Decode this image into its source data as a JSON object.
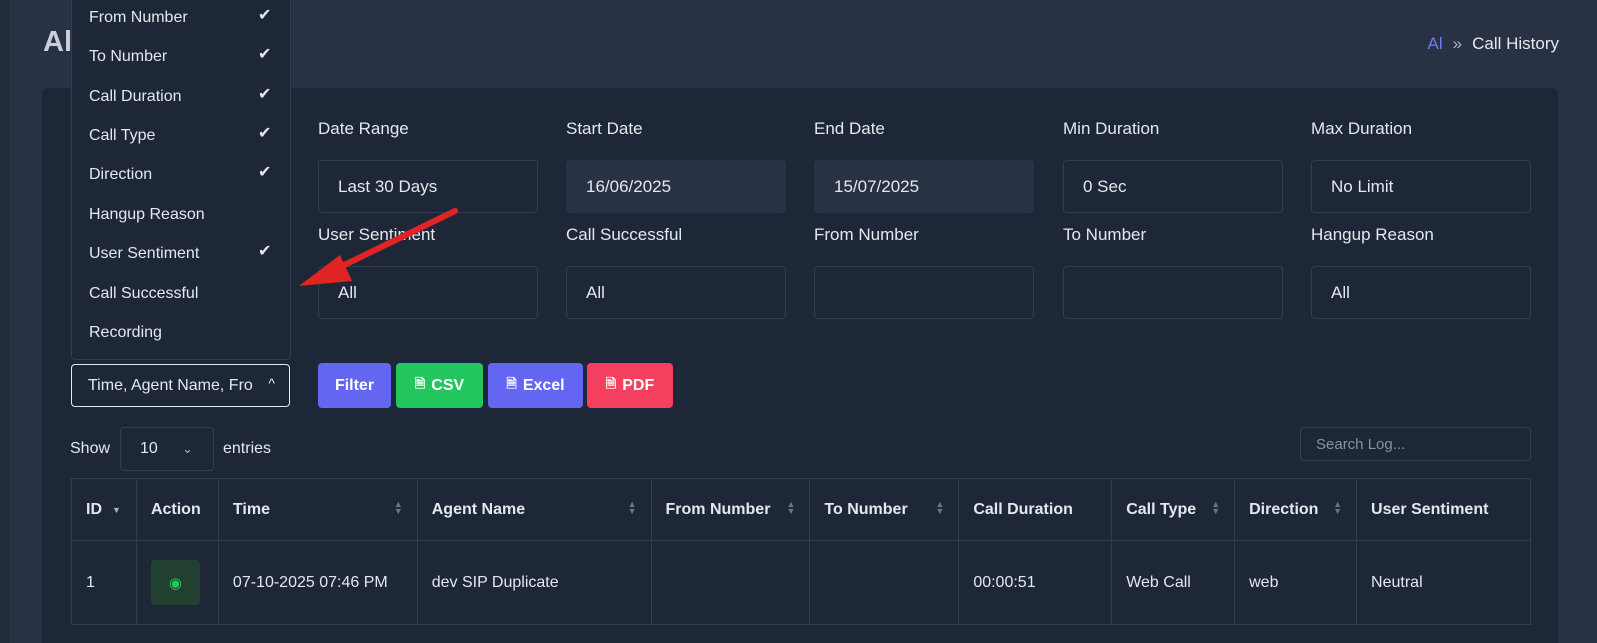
{
  "page": {
    "title": "Al"
  },
  "breadcrumb": {
    "link": "Al",
    "separator": "»",
    "current": "Call History"
  },
  "filters": {
    "date_range": {
      "label": "Date Range",
      "value": "Last 30 Days"
    },
    "start_date": {
      "label": "Start Date",
      "value": "16/06/2025"
    },
    "end_date": {
      "label": "End Date",
      "value": "15/07/2025"
    },
    "min_duration": {
      "label": "Min Duration",
      "value": "0 Sec"
    },
    "max_duration": {
      "label": "Max Duration",
      "value": "No Limit"
    },
    "user_sentiment": {
      "label": "User Sentiment",
      "value": "All"
    },
    "call_successful": {
      "label": "Call Successful",
      "value": "All"
    },
    "from_number": {
      "label": "From Number",
      "value": ""
    },
    "to_number": {
      "label": "To Number",
      "value": ""
    },
    "hangup_reason": {
      "label": "Hangup Reason",
      "value": "All"
    }
  },
  "column_select": {
    "value": "Time, Agent Name, Fro"
  },
  "buttons": {
    "filter": "Filter",
    "csv": "CSV",
    "excel": "Excel",
    "pdf": "PDF"
  },
  "entries": {
    "show": "Show",
    "value": "10",
    "suffix": "entries"
  },
  "search": {
    "placeholder": "Search Log..."
  },
  "dropdown": {
    "items": [
      {
        "label": "From Number",
        "checked": true
      },
      {
        "label": "To Number",
        "checked": true
      },
      {
        "label": "Call Duration",
        "checked": true
      },
      {
        "label": "Call Type",
        "checked": true
      },
      {
        "label": "Direction",
        "checked": true
      },
      {
        "label": "Hangup Reason",
        "checked": false
      },
      {
        "label": "User Sentiment",
        "checked": true
      },
      {
        "label": "Call Successful",
        "checked": false
      },
      {
        "label": "Recording",
        "checked": false
      }
    ],
    "check_glyph": "✔"
  },
  "table": {
    "headers": [
      "ID",
      "Action",
      "Time",
      "Agent Name",
      "From Number",
      "To Number",
      "Call Duration",
      "Call Type",
      "Direction",
      "User Sentiment"
    ],
    "rows": [
      {
        "id": "1",
        "time": "07-10-2025 07:46 PM",
        "agent": "dev SIP Duplicate",
        "from": "",
        "to": "",
        "duration": "00:00:51",
        "type": "Web Call",
        "direction": "web",
        "sentiment": "Neutral"
      }
    ]
  },
  "colors": {
    "accent": "#6366f1",
    "success": "#22c55e",
    "danger": "#f43f5e",
    "arrow": "#e02424"
  }
}
